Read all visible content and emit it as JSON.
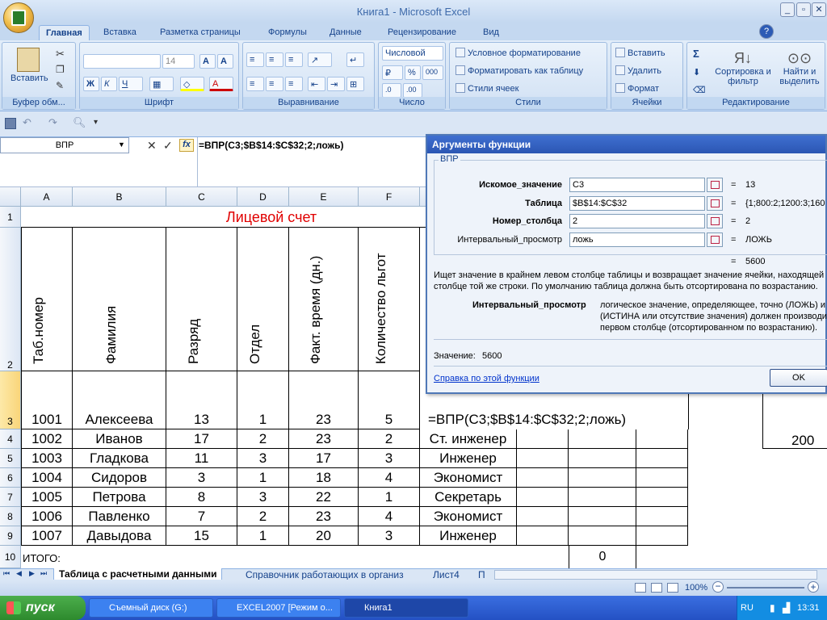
{
  "window": {
    "title": "Книга1 - Microsoft Excel"
  },
  "tabs": [
    "Главная",
    "Вставка",
    "Разметка страницы",
    "Формулы",
    "Данные",
    "Рецензирование",
    "Вид"
  ],
  "ribbon": {
    "paste": "Вставить",
    "font_size": "14",
    "number_format": "Числовой",
    "percent": "%",
    "thousands": "000",
    "cond_format": "Условное форматирование",
    "format_table": "Форматировать как таблицу",
    "cell_styles": "Стили ячеек",
    "insert": "Вставить",
    "delete": "Удалить",
    "format": "Формат",
    "sigma": "Σ",
    "sort": "Сортировка и фильтр",
    "find": "Найти и выделить",
    "groups": [
      "Буфер обм...",
      "Шрифт",
      "Выравнивание",
      "Число",
      "Стили",
      "Ячейки",
      "Редактирование"
    ]
  },
  "formula_bar": {
    "name_box": "ВПР",
    "fx": "fx",
    "formula": "=ВПР(C3;$B$14:$C$32;2;ложь)"
  },
  "columns": [
    "A",
    "B",
    "C",
    "D",
    "E",
    "F"
  ],
  "title_cell": "Лицевой счет",
  "headers": [
    "Таб.номер",
    "Фамилия",
    "Разряд",
    "Отдел",
    "Факт. время (дн.)",
    "Количество льгот"
  ],
  "rows": [
    [
      "1001",
      "Алексеева",
      "13",
      "1",
      "23",
      "5"
    ],
    [
      "1002",
      "Иванов",
      "17",
      "2",
      "23",
      "2"
    ],
    [
      "1003",
      "Гладкова",
      "11",
      "3",
      "17",
      "3"
    ],
    [
      "1004",
      "Сидоров",
      "3",
      "1",
      "18",
      "4"
    ],
    [
      "1005",
      "Петрова",
      "8",
      "3",
      "22",
      "1"
    ],
    [
      "1006",
      "Павленко",
      "7",
      "2",
      "23",
      "4"
    ],
    [
      "1007",
      "Давыдова",
      "15",
      "1",
      "20",
      "3"
    ]
  ],
  "col_g": [
    "",
    "Ст. инженер",
    "Инженер",
    "Экономист",
    "Секретарь",
    "Экономист",
    "Инженер"
  ],
  "row_nums": [
    "1",
    "2",
    "3",
    "4",
    "5",
    "6",
    "7",
    "8",
    "9",
    "10"
  ],
  "editing_formula": "=ВПР(C3;$B$14:$C$32;2;ложь)",
  "itogo": "ИТОГО:",
  "total_zero": "0",
  "partial_200": "200",
  "dialog": {
    "title": "Аргументы функции",
    "fn": "ВПР",
    "args": [
      {
        "label": "Искомое_значение",
        "value": "C3",
        "result": "13"
      },
      {
        "label": "Таблица",
        "value": "$B$14:$C$32",
        "result": "{1;800:2;1200:3;160"
      },
      {
        "label": "Номер_столбца",
        "value": "2",
        "result": "2"
      },
      {
        "label": "Интервальный_просмотр",
        "value": "ложь",
        "result": "ЛОЖЬ"
      }
    ],
    "eq": "=",
    "total": "5600",
    "desc1": "Ищет значение в крайнем левом столбце таблицы и возвращает значение ячейки, находящей",
    "desc2": "столбце той же строки. По умолчанию таблица должна быть отсортирована по возрастанию.",
    "argname": "Интервальный_просмотр",
    "arg1": "логическое значение, определяющее, точно (ЛОЖЬ) и",
    "arg2": "(ИСТИНА или отсутствие значения) должен производит",
    "arg3": "первом столбце (отсортированном по возрастанию).",
    "value_label": "Значение:",
    "value": "5600",
    "help": "Справка по этой функции",
    "ok": "OK"
  },
  "sheets": [
    "Таблица с расчетными данными",
    "Справочник работающих в организ",
    "Лист4",
    "П"
  ],
  "zoom": "100%",
  "taskbar": {
    "start": "пуск",
    "items": [
      "Съемный диск (G:)",
      "EXCEL2007 [Режим о...",
      "Книга1"
    ],
    "lang": "RU",
    "clock": "13:31"
  }
}
